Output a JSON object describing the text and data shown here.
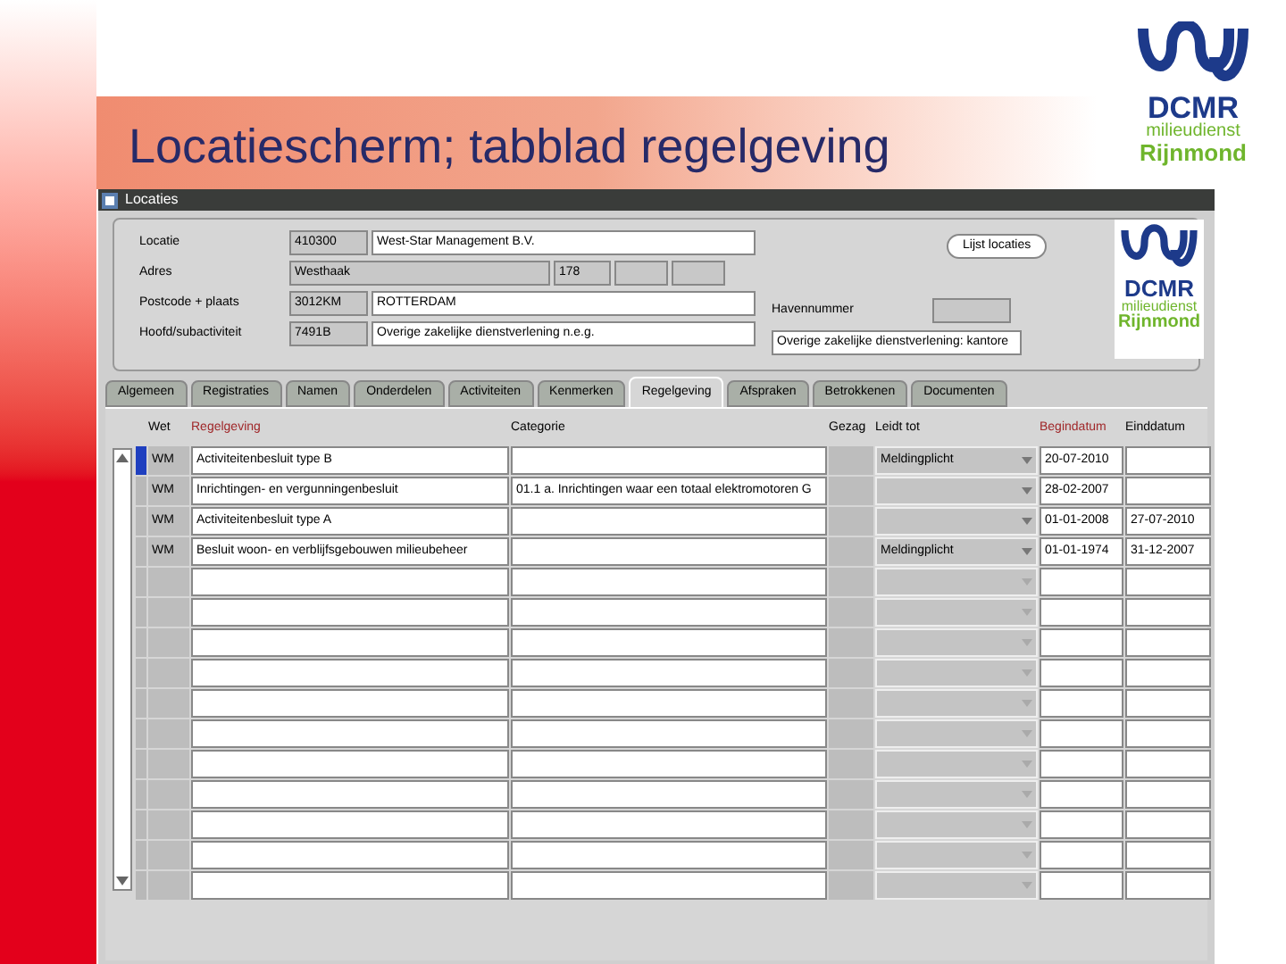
{
  "slide": {
    "title": "Locatiescherm; tabblad regelgeving",
    "logo": {
      "name": "DCMR",
      "line1": "milieudienst",
      "line2": "Rijnmond"
    }
  },
  "window": {
    "title": "Locaties"
  },
  "form": {
    "fields": [
      {
        "label": "Locatie",
        "values": [
          "410300",
          "West-Star Management B.V."
        ]
      },
      {
        "label": "Adres",
        "values": [
          "Westhaak",
          "178"
        ]
      },
      {
        "label": "Postcode + plaats",
        "values": [
          "3012KM",
          "ROTTERDAM"
        ]
      },
      {
        "label": "Hoofd/subactiviteit",
        "values": [
          "7491B",
          "Overige zakelijke dienstverlening n.e.g."
        ]
      }
    ],
    "button": "Lijst locaties",
    "havennummer_label": "Havennummer",
    "side_value": "Overige zakelijke dienstverlening: kantore",
    "logo": {
      "name": "DCMR",
      "line1": "milieudienst",
      "line2": "Rijnmond"
    }
  },
  "tabs": [
    {
      "label": "Algemeen",
      "selected": false
    },
    {
      "label": "Registraties",
      "selected": false
    },
    {
      "label": "Namen",
      "selected": false
    },
    {
      "label": "Onderdelen",
      "selected": false
    },
    {
      "label": "Activiteiten",
      "selected": false
    },
    {
      "label": "Kenmerken",
      "selected": false
    },
    {
      "label": "Regelgeving",
      "selected": true
    },
    {
      "label": "Afspraken",
      "selected": false
    },
    {
      "label": "Betrokkenen",
      "selected": false
    },
    {
      "label": "Documenten",
      "selected": false
    }
  ],
  "table": {
    "columns": [
      {
        "label": "Wet",
        "required": false
      },
      {
        "label": "Regelgeving",
        "required": true
      },
      {
        "label": "Categorie",
        "required": false
      },
      {
        "label": "Gezag",
        "required": false
      },
      {
        "label": "Leidt tot",
        "required": false
      },
      {
        "label": "Begindatum",
        "required": true
      },
      {
        "label": "Einddatum",
        "required": false
      }
    ],
    "rows": [
      {
        "selected": true,
        "wet": "WM",
        "regelgeving": "Activiteitenbesluit type B",
        "leidt_tot": "Meldingplicht",
        "begindatum": "20-07-2010"
      },
      {
        "selected": false,
        "wet": "WM",
        "regelgeving": "Inrichtingen- en vergunningenbesluit",
        "categorie": "01.1 a. Inrichtingen waar een totaal elektromotoren G",
        "begindatum": "28-02-2007"
      },
      {
        "selected": false,
        "wet": "WM",
        "regelgeving": "Activiteitenbesluit type A",
        "begindatum": "01-01-2008",
        "einddatum": "27-07-2010"
      },
      {
        "selected": false,
        "wet": "WM",
        "regelgeving": "Besluit woon- en verblijfsgebouwen milieubeheer",
        "leidt_tot": "Meldingplicht",
        "begindatum": "01-01-1974",
        "einddatum": "31-12-2007"
      }
    ]
  }
}
